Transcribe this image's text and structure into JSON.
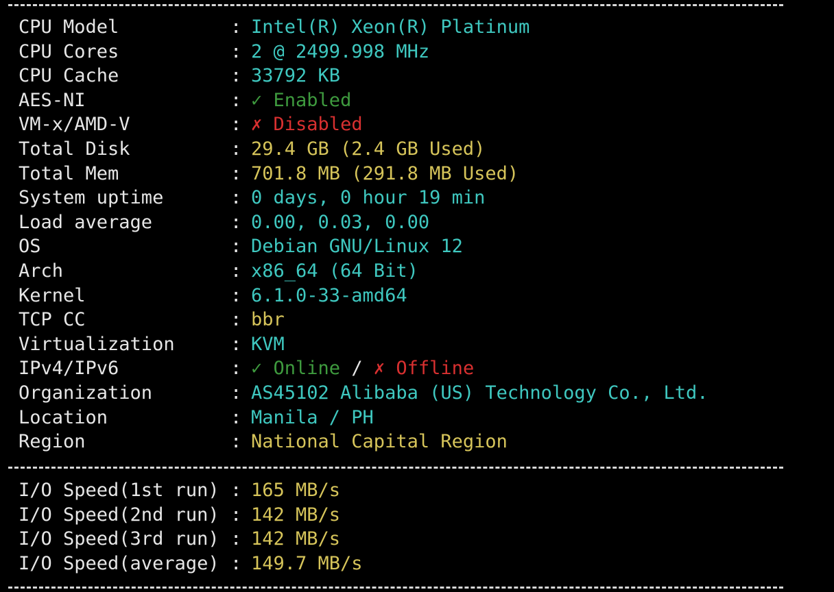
{
  "colors": {
    "background": "#000000",
    "label": "#e6e6e6",
    "cyan": "#3fc8c0",
    "yellow": "#d6c45a",
    "green": "#3e9a3e",
    "red": "#d83030",
    "slash": "#e6e6e6"
  },
  "separator": "------------------------------------------------------------------------",
  "colon": ":",
  "rows": [
    {
      "label": "CPU Model",
      "value": "Intel(R) Xeon(R) Platinum",
      "color": "cyan"
    },
    {
      "label": "CPU Cores",
      "value": "2 @ 2499.998 MHz",
      "color": "cyan"
    },
    {
      "label": "CPU Cache",
      "value": "33792 KB",
      "color": "cyan"
    },
    {
      "label": "AES-NI",
      "icon": "check-icon",
      "icon_glyph": "✓",
      "value": "Enabled",
      "color": "green"
    },
    {
      "label": "VM-x/AMD-V",
      "icon": "cross-icon",
      "icon_glyph": "✗",
      "value": "Disabled",
      "color": "red"
    },
    {
      "label": "Total Disk",
      "value": "29.4 GB (2.4 GB Used)",
      "color": "yellow"
    },
    {
      "label": "Total Mem",
      "value": "701.8 MB (291.8 MB Used)",
      "color": "yellow"
    },
    {
      "label": "System uptime",
      "value": "0 days, 0 hour 19 min",
      "color": "cyan"
    },
    {
      "label": "Load average",
      "value": "0.00, 0.03, 0.00",
      "color": "cyan"
    },
    {
      "label": "OS",
      "value": "Debian GNU/Linux 12",
      "color": "cyan"
    },
    {
      "label": "Arch",
      "value": "x86_64 (64 Bit)",
      "color": "cyan"
    },
    {
      "label": "Kernel",
      "value": "6.1.0-33-amd64",
      "color": "cyan"
    },
    {
      "label": "TCP CC",
      "value": "bbr",
      "color": "yellow"
    },
    {
      "label": "Virtualization",
      "value": "KVM",
      "color": "cyan"
    },
    {
      "label": "IPv4/IPv6",
      "ipv": {
        "v4_icon": "check-icon",
        "v4_glyph": "✓",
        "v4_status": "Online",
        "slash": "/",
        "v6_icon": "cross-icon",
        "v6_glyph": "✗",
        "v6_status": "Offline"
      }
    },
    {
      "label": "Organization",
      "value": "AS45102 Alibaba (US) Technology Co., Ltd.",
      "color": "cyan"
    },
    {
      "label": "Location",
      "value": "Manila / PH",
      "color": "cyan"
    },
    {
      "label": "Region",
      "value": "National Capital Region",
      "color": "yellow"
    }
  ],
  "io_rows": [
    {
      "label": "I/O Speed(1st run)",
      "value": "165 MB/s",
      "color": "yellow"
    },
    {
      "label": "I/O Speed(2nd run)",
      "value": "142 MB/s",
      "color": "yellow"
    },
    {
      "label": "I/O Speed(3rd run)",
      "value": "142 MB/s",
      "color": "yellow"
    },
    {
      "label": "I/O Speed(average)",
      "value": "149.7 MB/s",
      "color": "yellow"
    }
  ]
}
